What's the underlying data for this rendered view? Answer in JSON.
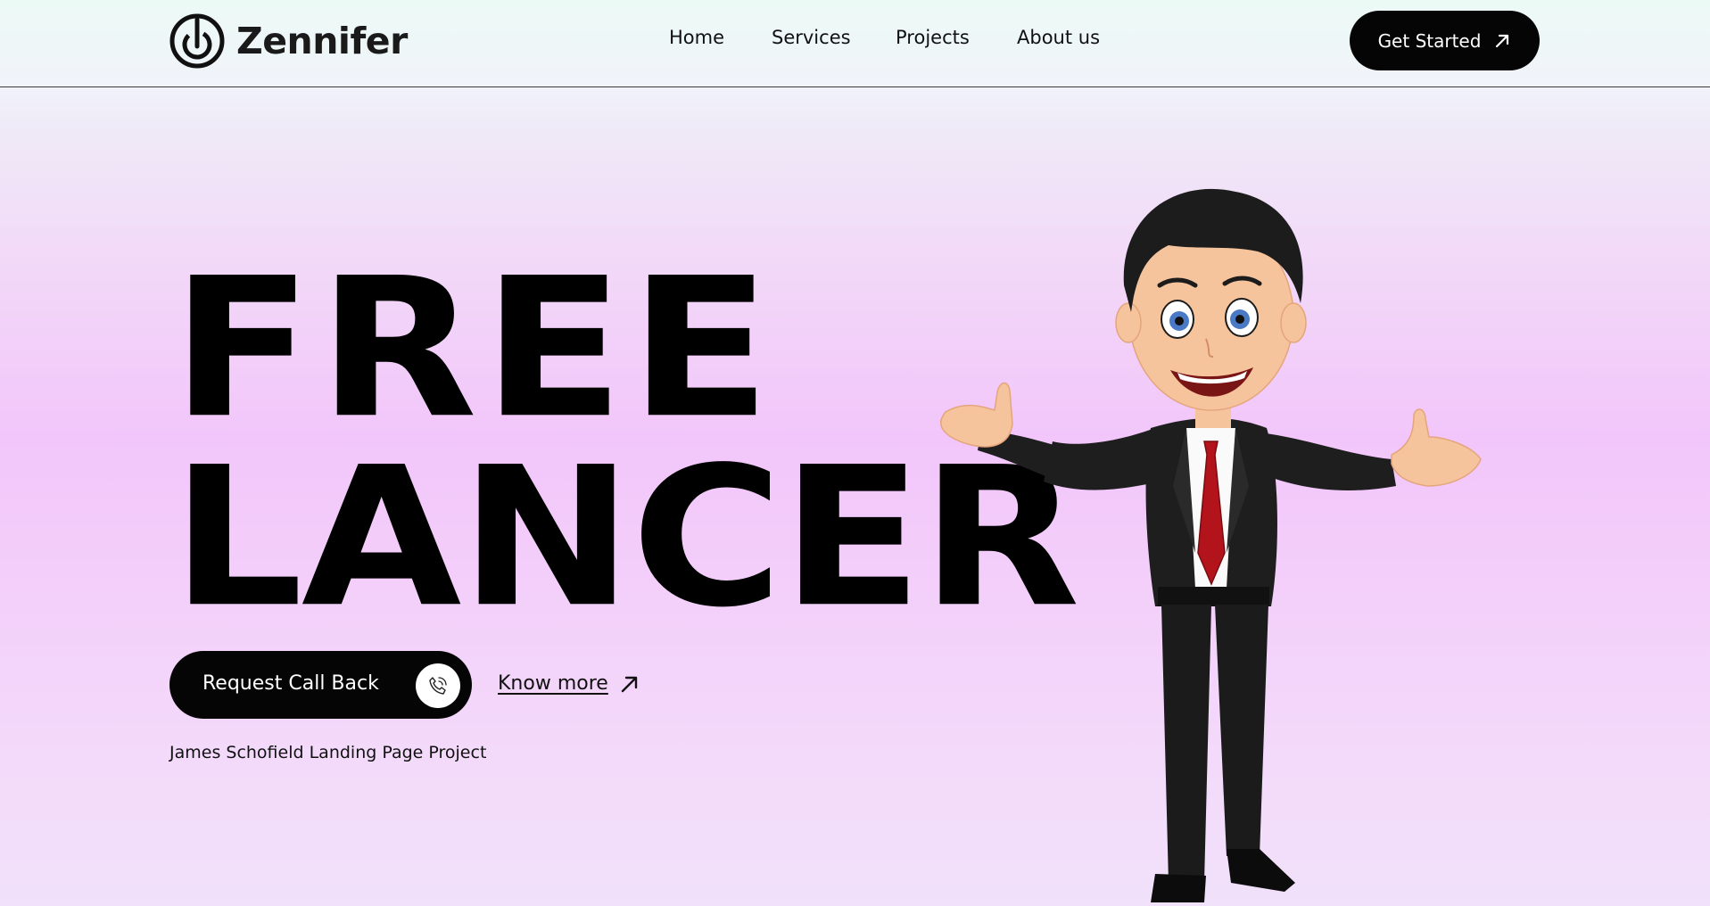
{
  "header": {
    "brand": "Zennifer",
    "nav": [
      {
        "label": "Home"
      },
      {
        "label": "Services"
      },
      {
        "label": "Projects"
      },
      {
        "label": "About us"
      }
    ],
    "cta_label": "Get Started",
    "cta_icon": "arrow-up-right-icon"
  },
  "hero": {
    "title_line1": "FREE",
    "title_line2": "LANCER",
    "request_label": "Request Call Back",
    "request_icon": "phone-icon",
    "know_more_label": "Know more",
    "know_more_icon": "arrow-up-right-icon",
    "caption": "James Schofield Landing Page Project",
    "illustration": "cartoon-businessman"
  },
  "colors": {
    "primary": "#050505",
    "background_top": "#eefaf7",
    "background_mid": "#f2c6fa",
    "tie": "#b3141c",
    "suit": "#1e1e1e"
  }
}
